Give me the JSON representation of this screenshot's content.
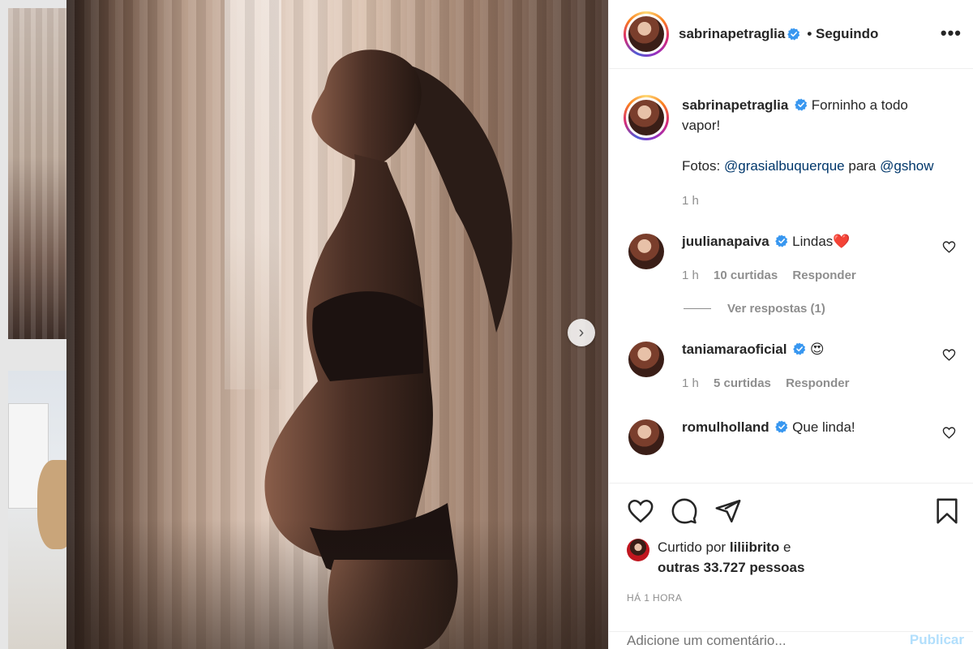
{
  "post": {
    "author": "sabrinapetraglia",
    "follow_status": "• Seguindo",
    "more_label": "•••",
    "caption_line1": "Forninho a todo vapor!",
    "caption_credit_prefix": "Fotos:",
    "caption_mention1": "@grasialbuquerque",
    "caption_mid": "para",
    "caption_mention2": "@gshow",
    "caption_time": "1 h"
  },
  "comments": [
    {
      "user": "juulianapaiva",
      "text": "Lindas❤️",
      "time": "1 h",
      "likes": "10 curtidas",
      "reply": "Responder",
      "view_replies": "Ver respostas (1)"
    },
    {
      "user": "taniamaraoficial",
      "text": "😍",
      "time": "1 h",
      "likes": "5 curtidas",
      "reply": "Responder"
    },
    {
      "user": "romulholland",
      "text": "Que linda!"
    }
  ],
  "likes": {
    "prefix": "Curtido por",
    "user": "liliibrito",
    "and": "e",
    "others": "outras 33.727 pessoas"
  },
  "posted_time": "HÁ 1 HORA",
  "add_comment": {
    "placeholder": "Adicione um comentário...",
    "publish": "Publicar"
  },
  "colors": {
    "link": "#00376b",
    "muted": "#8e8e8e",
    "verified": "#3897f0",
    "publish_disabled": "#b2dffc"
  }
}
